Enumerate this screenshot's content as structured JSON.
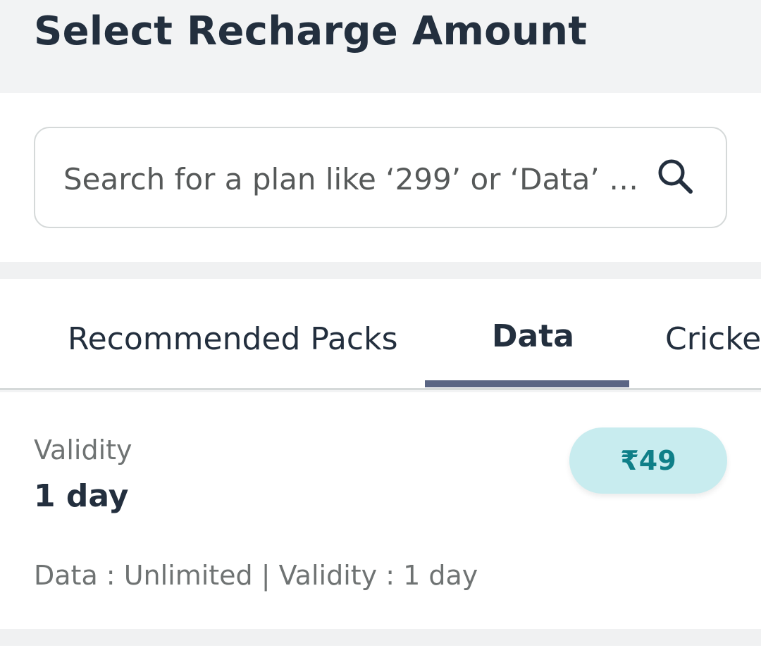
{
  "header": {
    "title": "Select Recharge Amount"
  },
  "search": {
    "placeholder": "Search for a plan like ‘299’ or ‘Data’ …",
    "icon": "search-icon"
  },
  "tabs": [
    {
      "label": "Recommended Packs",
      "selected": false
    },
    {
      "label": "Data",
      "selected": true
    },
    {
      "label": "Cricket",
      "selected": false
    }
  ],
  "plan": {
    "validity_label": "Validity",
    "validity_value": "1 day",
    "price": "₹49",
    "description": "Data : Unlimited | Validity : 1 day"
  },
  "colors": {
    "accent_underline": "#5a6584",
    "price_bg": "#c8ecef",
    "price_text": "#0f7f88",
    "title_text": "#232f3e"
  }
}
